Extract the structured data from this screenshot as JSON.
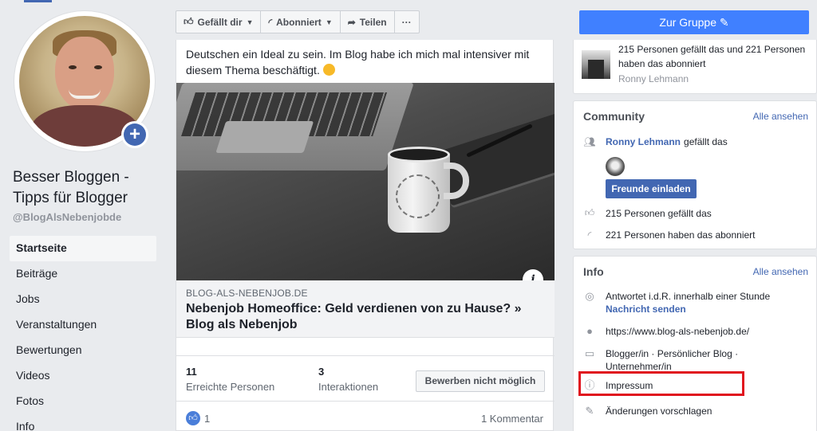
{
  "page": {
    "name": "Besser Bloggen - Tipps für Blogger",
    "handle": "@BlogAlsNebenjobde"
  },
  "nav": {
    "items": [
      {
        "label": "Startseite",
        "active": true
      },
      {
        "label": "Beiträge"
      },
      {
        "label": "Jobs"
      },
      {
        "label": "Veranstaltungen"
      },
      {
        "label": "Bewertungen"
      },
      {
        "label": "Videos"
      },
      {
        "label": "Fotos"
      },
      {
        "label": "Info"
      }
    ]
  },
  "toolbar": {
    "like_label": "Gefällt dir",
    "follow_label": "Abonniert",
    "share_label": "Teilen",
    "more_label": "···"
  },
  "post": {
    "text": "Deutschen ein Ideal zu sein. Im Blog habe ich mich mal intensiver mit diesem Thema beschäftigt.",
    "link_domain": "BLOG-ALS-NEBENJOB.DE",
    "link_title": "Nebenjob Homeoffice: Geld verdienen von zu Hause? » Blog als Nebenjob",
    "reach_num": "11",
    "reach_label": "Erreichte Personen",
    "interactions_num": "3",
    "interactions_label": "Interaktionen",
    "boost_label": "Bewerben nicht möglich",
    "likes_count": "1",
    "comments_label": "1 Kommentar"
  },
  "right": {
    "join_label": "Zur Gruppe",
    "top_card": {
      "text": "215 Personen gefällt das und 221 Personen haben das abonniert",
      "sub": "Ronny Lehmann"
    },
    "community": {
      "title": "Community",
      "see_all": "Alle ansehen",
      "friend_name": "Ronny Lehmann",
      "friend_suffix": "gefällt das",
      "invite_label": "Freunde einladen",
      "likes_text": "215 Personen gefällt das",
      "follows_text": "221 Personen haben das abonniert"
    },
    "info": {
      "title": "Info",
      "see_all": "Alle ansehen",
      "response_text": "Antwortet i.d.R. innerhalb einer Stunde",
      "message_label": "Nachricht senden",
      "website": "https://www.blog-als-nebenjob.de/",
      "category": "Blogger/in · Persönlicher Blog · Unternehmer/in",
      "impressum": "Impressum",
      "suggest": "Änderungen vorschlagen"
    }
  },
  "colors": {
    "brand": "#4267b2",
    "join_button": "#4080ff",
    "highlight": "#e0131e"
  }
}
